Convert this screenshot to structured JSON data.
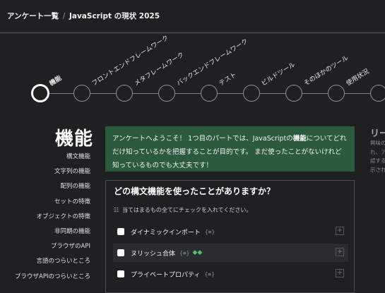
{
  "breadcrumb": {
    "parent": "アンケート一覧",
    "separator": "/",
    "current": "JavaScript の現状 2025"
  },
  "steps": [
    {
      "label": "機能",
      "active": true
    },
    {
      "label": "フロントエンドフレームワーク"
    },
    {
      "label": "メタフレームワーク"
    },
    {
      "label": "バックエンドフレームワーク"
    },
    {
      "label": "テスト"
    },
    {
      "label": "ビルドツール"
    },
    {
      "label": "そのほかのツール"
    },
    {
      "label": "使用状況"
    }
  ],
  "section_title": "機能",
  "sidebar": {
    "items": [
      "構文機能",
      "文字列の機能",
      "配列の機能",
      "セットの特徴",
      "オブジェクトの特徴",
      "非同期の機能",
      "ブラウザのAPI",
      "言語のつらいところ",
      "ブラウザAPIのつらいところ"
    ]
  },
  "intro": {
    "before": "アンケートへようこそ！ 1つ目のパートでは、JavaScriptの",
    "bold": "機能",
    "after": "についてどれだけ知っているかを把握することが目的です。 まだ使ったことがないけれど知っているものでも大丈夫です！"
  },
  "question": {
    "title": "どの構文機能を使ったことがありますか？",
    "hint_icon": "checklist-icon",
    "hint": "当てはまるもの全てにチェックを入れてください。",
    "brace_glyph": "{≡}",
    "options": [
      {
        "label": "ダイナミックインポート",
        "checked": false
      },
      {
        "label": "ヌリッシュ合体",
        "checked": false,
        "badge": "baseline-arrows-icon"
      },
      {
        "label": "プライベートプロパティ",
        "checked": false
      }
    ]
  },
  "right_panel": {
    "heading": "リー",
    "lines": [
      "興味の",
      "れ、ア",
      "認する",
      "示され"
    ]
  }
}
